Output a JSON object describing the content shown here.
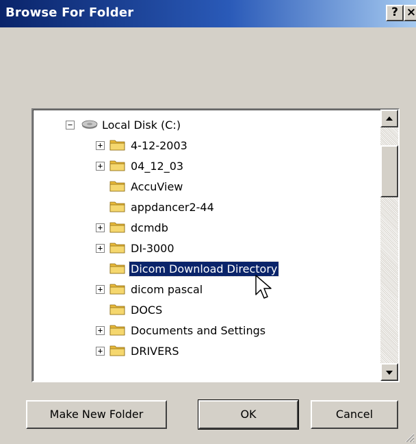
{
  "window": {
    "title": "Browse For Folder",
    "help_label": "?",
    "close_label": "×"
  },
  "tree": {
    "root": {
      "label": "Local Disk (C:)",
      "expander": "−",
      "icon": "hard-disk-icon"
    },
    "items": [
      {
        "label": "4-12-2003",
        "expandable": true,
        "selected": false
      },
      {
        "label": "04_12_03",
        "expandable": true,
        "selected": false
      },
      {
        "label": "AccuView",
        "expandable": false,
        "selected": false
      },
      {
        "label": "appdancer2-44",
        "expandable": false,
        "selected": false
      },
      {
        "label": "dcmdb",
        "expandable": true,
        "selected": false
      },
      {
        "label": "DI-3000",
        "expandable": true,
        "selected": false
      },
      {
        "label": "Dicom Download Directory",
        "expandable": false,
        "selected": true
      },
      {
        "label": "dicom pascal",
        "expandable": true,
        "selected": false
      },
      {
        "label": "DOCS",
        "expandable": false,
        "selected": false
      },
      {
        "label": "Documents and Settings",
        "expandable": true,
        "selected": false
      },
      {
        "label": "DRIVERS",
        "expandable": true,
        "selected": false
      }
    ],
    "expander_plus": "+"
  },
  "buttons": {
    "make_new_folder": "Make New Folder",
    "ok": "OK",
    "cancel": "Cancel"
  },
  "colors": {
    "title_start": "#0a246a",
    "title_end": "#a6caf0",
    "face": "#d4d0c8",
    "selection": "#0a246a",
    "folder": "#f5d76e"
  }
}
